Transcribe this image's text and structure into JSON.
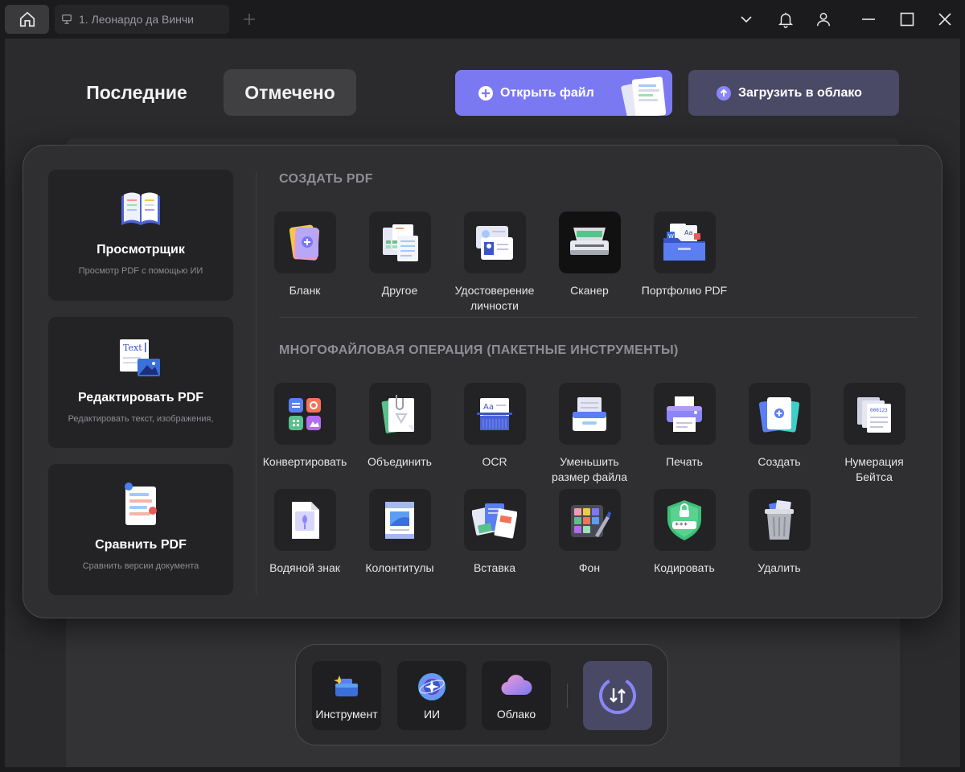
{
  "titlebar": {
    "tab_label": "1. Леонардо да Винчи"
  },
  "header": {
    "recent_label": "Последние",
    "marked_label": "Отмечено",
    "open_file_label": "Открыть файл",
    "upload_label": "Загрузить в облако"
  },
  "side_cards": [
    {
      "title": "Просмотрщик",
      "subtitle": "Просмотр PDF с помощью ИИ"
    },
    {
      "title": "Редактировать PDF",
      "subtitle": "Редактировать текст, изображения,"
    },
    {
      "title": "Сравнить PDF",
      "subtitle": "Сравнить версии документа"
    }
  ],
  "create_section": {
    "title": "СОЗДАТЬ PDF",
    "items": [
      "Бланк",
      "Другое",
      "Удостоверение личности",
      "Сканер",
      "Портфолио PDF"
    ]
  },
  "batch_section": {
    "title": "МНОГОФАЙЛОВАЯ ОПЕРАЦИЯ (ПАКЕТНЫЕ ИНСТРУМЕНТЫ)",
    "items": [
      "Конвертировать",
      "Объединить",
      "OCR",
      "Уменьшить размер файла",
      "Печать",
      "Создать",
      "Нумерация Бейтса",
      "Водяной знак",
      "Колонтитулы",
      "Вставка",
      "Фон",
      "Кодировать",
      "Удалить"
    ]
  },
  "dock": {
    "tool_label": "Инструмент",
    "ai_label": "ИИ",
    "cloud_label": "Облако"
  },
  "colors": {
    "accent": "#7b79f2",
    "upload_bg": "#4a4966",
    "popup_bg": "#2f2f31"
  }
}
